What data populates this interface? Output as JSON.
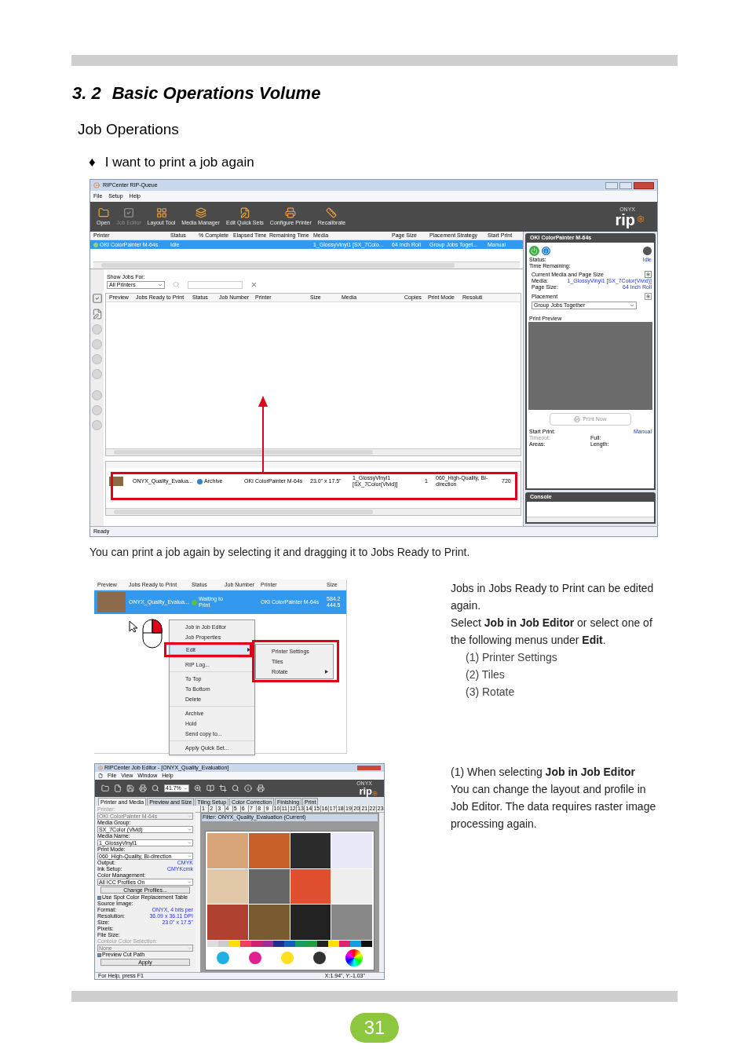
{
  "section_number": "3. 2",
  "section_title": "Basic Operations Volume",
  "heading": "Job Operations",
  "topic": {
    "bullet": "♦",
    "text": "I want to print a job again"
  },
  "rip_queue": {
    "title": "RIPCenter RIP-Queue",
    "menu": [
      "File",
      "Setup",
      "Help"
    ],
    "toolbar": [
      {
        "label": "Open",
        "disabled": false
      },
      {
        "label": "Job Editor",
        "disabled": true
      },
      {
        "label": "Layout Tool",
        "disabled": false
      },
      {
        "label": "Media Manager",
        "disabled": false
      },
      {
        "label": "Edit Quick Sets",
        "disabled": false
      },
      {
        "label": "Configure Printer",
        "disabled": false
      },
      {
        "label": "Recalibrate",
        "disabled": false
      }
    ],
    "logo_small": "ONYX",
    "logo": "rip",
    "printers": {
      "columns": [
        "Printer",
        "Status",
        "% Complete",
        "Elapsed Time",
        "Remaining Time",
        "Media",
        "Page Size",
        "Placement Strategy",
        "Start Print"
      ],
      "rows": [
        {
          "selected": true,
          "cells": [
            "OKI ColorPainter M-64s",
            "Idle",
            "",
            "",
            "",
            "1_GlossyVinyl1 [SX_7Colo...",
            "64 Inch Roll",
            "Group Jobs Toget...",
            "Manual"
          ]
        }
      ]
    },
    "show_jobs_label": "Show Jobs For:",
    "show_jobs_value": "All Printers",
    "jobs_columns": [
      "Preview",
      "Jobs Ready to Print",
      "Status",
      "Job Number",
      "Printer",
      "Size",
      "Media",
      "Copies",
      "Print Mode",
      "Resoluti"
    ],
    "printed_jobs": [
      {
        "cells": [
          "ONYX_Quality_Evalua...",
          "Archive",
          "",
          "OKI ColorPainter M-64s",
          "23.0\" x 17.5\"",
          "1_GlossyVinyl1 [SX_7Color(Vivid)]",
          "1",
          "060_High-Quality, Bi-direction",
          "720"
        ]
      }
    ],
    "panel": {
      "title": "OKI ColorPainter M-64s",
      "status_label": "Status:",
      "status": "Idle",
      "time_label": "Time Remaining:",
      "media_group": "Current Media and Page Size",
      "media_label": "Media:",
      "media": "1_GlossyVinyl1 [SX_7Color(Vivid)]",
      "page_size_label": "Page Size:",
      "page_size": "64 Inch Roll",
      "placement_group": "Placement",
      "placement": "Group Jobs Together",
      "preview_label": "Print Preview",
      "print_now": "Print Now",
      "start_label": "Start Print:",
      "start": "Manual",
      "timeout_label": "Timeout:",
      "full_label": "Full:",
      "areas_label": "Areas:",
      "length_label": "Length:"
    },
    "console": "Console",
    "status_bar": "Ready"
  },
  "caption": "You can print a job again by selecting it and dragging it to Jobs Ready to Print.",
  "context_shot": {
    "columns": [
      "Preview",
      "Jobs Ready to Print",
      "Status",
      "Job Number",
      "Printer",
      "Size"
    ],
    "row": {
      "name": "ONYX_Quality_Evalua...",
      "status": "Waiting to Print",
      "printer": "OKI ColorPainter M-64s",
      "size": [
        "584.2",
        "444.5"
      ]
    },
    "menu": [
      [
        {
          "label": "Job in Job Editor",
          "selected": false,
          "submenu": false
        },
        {
          "label": "Job Properties",
          "selected": false,
          "submenu": false
        },
        {
          "label": "Edit",
          "selected": true,
          "submenu": true
        }
      ],
      [
        {
          "label": "RIP Log...",
          "selected": false,
          "submenu": false
        }
      ],
      [
        {
          "label": "To Top",
          "selected": false,
          "submenu": false
        },
        {
          "label": "To Bottom",
          "selected": false,
          "submenu": false
        },
        {
          "label": "Delete",
          "selected": false,
          "submenu": false
        }
      ],
      [
        {
          "label": "Archive",
          "selected": false,
          "submenu": false
        },
        {
          "label": "Hold",
          "selected": false,
          "submenu": false
        },
        {
          "label": "Send copy to...",
          "selected": false,
          "submenu": false
        }
      ],
      [
        {
          "label": "Apply Quick Set...",
          "selected": false,
          "submenu": false
        }
      ]
    ],
    "submenu": [
      {
        "label": "Printer Settings",
        "submenu": false
      },
      {
        "label": "Tiles",
        "submenu": false
      },
      {
        "label": "Rotate",
        "submenu": true
      }
    ]
  },
  "edit_text": {
    "lines": [
      "Jobs in Jobs Ready to Print can be edited again.",
      "Select **Job in Job Editor** or select one of the following menus under **Edit**."
    ],
    "options": [
      "(1) Printer Settings",
      "(2) Tiles",
      "(3) Rotate"
    ]
  },
  "editor_shot": {
    "title": "RIPCenter Job Editor - [ONYX_Quality_Evaluation]",
    "menu": [
      "File",
      "View",
      "Window",
      "Help"
    ],
    "zoom": "41.7%",
    "logo_small": "ONYX",
    "logo": "rip",
    "tabs": [
      {
        "label": "Printer and Media",
        "selected": true
      },
      {
        "label": "Preview and Size",
        "selected": false
      },
      {
        "label": "Tiling Setup",
        "selected": false
      },
      {
        "label": "Color Correction",
        "selected": false
      },
      {
        "label": "Finishing",
        "selected": false
      },
      {
        "label": "Print",
        "selected": false
      }
    ],
    "fields": [
      {
        "kind": "select",
        "label": "Printer:",
        "value": "OKI ColorPainter M-64s",
        "disabled": true
      },
      {
        "kind": "select",
        "label": "Media Group:",
        "value": "SX_7Color (Vivid)",
        "disabled": false
      },
      {
        "kind": "select",
        "label": "Media Name:",
        "value": "1_GlossyVinyl1",
        "disabled": false
      },
      {
        "kind": "select",
        "label": "Print Mode:",
        "value": "060_High-Quality, Bi-direction",
        "disabled": false
      },
      {
        "kind": "value",
        "label": "Output:",
        "value": "CMYK"
      },
      {
        "kind": "value",
        "label": "Ink Setup:",
        "value": "CMYKcmk"
      },
      {
        "kind": "select",
        "label": "Color Management:",
        "value": "All ICC Profiles On",
        "disabled": false
      },
      {
        "kind": "button",
        "label": "Change Profiles..."
      },
      {
        "kind": "checkbox",
        "label": "Use Spot Color Replacement Table",
        "checked": true
      },
      {
        "kind": "heading",
        "label": "Source Image:"
      },
      {
        "kind": "value",
        "label": "Format:",
        "value": "ONYX, 4 bits per"
      },
      {
        "kind": "value",
        "label": "Resolution:",
        "value": "36.09 x 36.11 DPI"
      },
      {
        "kind": "value",
        "label": "Size:",
        "value": "23.0\" x 17.5\""
      },
      {
        "kind": "value",
        "label": "Pixels:"
      },
      {
        "kind": "value",
        "label": "File Size:"
      },
      {
        "kind": "select",
        "label": "Contour Color Selection:",
        "value": "None",
        "disabled": true
      },
      {
        "kind": "checkbox",
        "label": "Preview Cut Path",
        "checked": true
      },
      {
        "kind": "button",
        "label": "Apply"
      }
    ],
    "ruler": [
      "1",
      "2",
      "3",
      "4",
      "5",
      "6",
      "7",
      "8",
      "9",
      "10",
      "11",
      "12",
      "13",
      "14",
      "15",
      "16",
      "17",
      "18",
      "19",
      "20",
      "21",
      "22",
      "23"
    ],
    "filter": "Filter: ONYX_Quality_Evaluation (Current)",
    "status_left": "For Help, press F1",
    "status_right": "X:1.94\", Y:-1.03\""
  },
  "editor_text": {
    "title": "(1) When selecting **Job in Job Editor**",
    "body": "You can change the layout and profile in Job Editor. The data requires raster image processing again."
  },
  "page_number": "31"
}
